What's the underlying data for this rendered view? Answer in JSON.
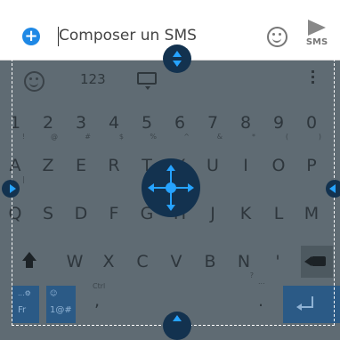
{
  "compose": {
    "placeholder": "Composer un SMS",
    "send_label": "SMS"
  },
  "keyboard": {
    "toolbar_numbers": "123",
    "row1": [
      {
        "k": "1",
        "s": "!"
      },
      {
        "k": "2",
        "s": "@"
      },
      {
        "k": "3",
        "s": "#"
      },
      {
        "k": "4",
        "s": "$"
      },
      {
        "k": "5",
        "s": "%"
      },
      {
        "k": "6",
        "s": "^"
      },
      {
        "k": "7",
        "s": "&"
      },
      {
        "k": "8",
        "s": "*"
      },
      {
        "k": "9",
        "s": "("
      },
      {
        "k": "0",
        "s": ")"
      }
    ],
    "row2": [
      {
        "k": "A",
        "s": "|"
      },
      {
        "k": "Z",
        "s": ""
      },
      {
        "k": "E",
        "s": ""
      },
      {
        "k": "R",
        "s": ""
      },
      {
        "k": "T",
        "s": ""
      },
      {
        "k": "Y",
        "s": ""
      },
      {
        "k": "U",
        "s": ""
      },
      {
        "k": "I",
        "s": ""
      },
      {
        "k": "O",
        "s": ""
      },
      {
        "k": "P",
        "s": ""
      }
    ],
    "row3": [
      {
        "k": "Q",
        "s": ""
      },
      {
        "k": "S",
        "s": ""
      },
      {
        "k": "D",
        "s": ""
      },
      {
        "k": "F",
        "s": ""
      },
      {
        "k": "G",
        "s": ""
      },
      {
        "k": "H",
        "s": ""
      },
      {
        "k": "J",
        "s": ""
      },
      {
        "k": "K",
        "s": ""
      },
      {
        "k": "L",
        "s": ""
      },
      {
        "k": "M",
        "s": ""
      }
    ],
    "row4": [
      {
        "k": "W",
        "s": ""
      },
      {
        "k": "X",
        "s": ""
      },
      {
        "k": "C",
        "s": ""
      },
      {
        "k": "V",
        "s": ""
      },
      {
        "k": "B",
        "s": ""
      },
      {
        "k": "N",
        "s": "?"
      },
      {
        "k": "'",
        "s": ""
      }
    ],
    "bottom": {
      "lang_label": "Fr",
      "lang_sub": "...⚙",
      "symbols_label": "1@#",
      "symbols_sub": "☺",
      "comma": ",",
      "comma_sub": "Ctrl",
      "period": ".",
      "period_sub": "..."
    }
  },
  "colors": {
    "accent": "#26a3ff",
    "handle": "#13324f",
    "keyboard_bg": "#5f6b73",
    "action_key": "#2b5a86"
  }
}
